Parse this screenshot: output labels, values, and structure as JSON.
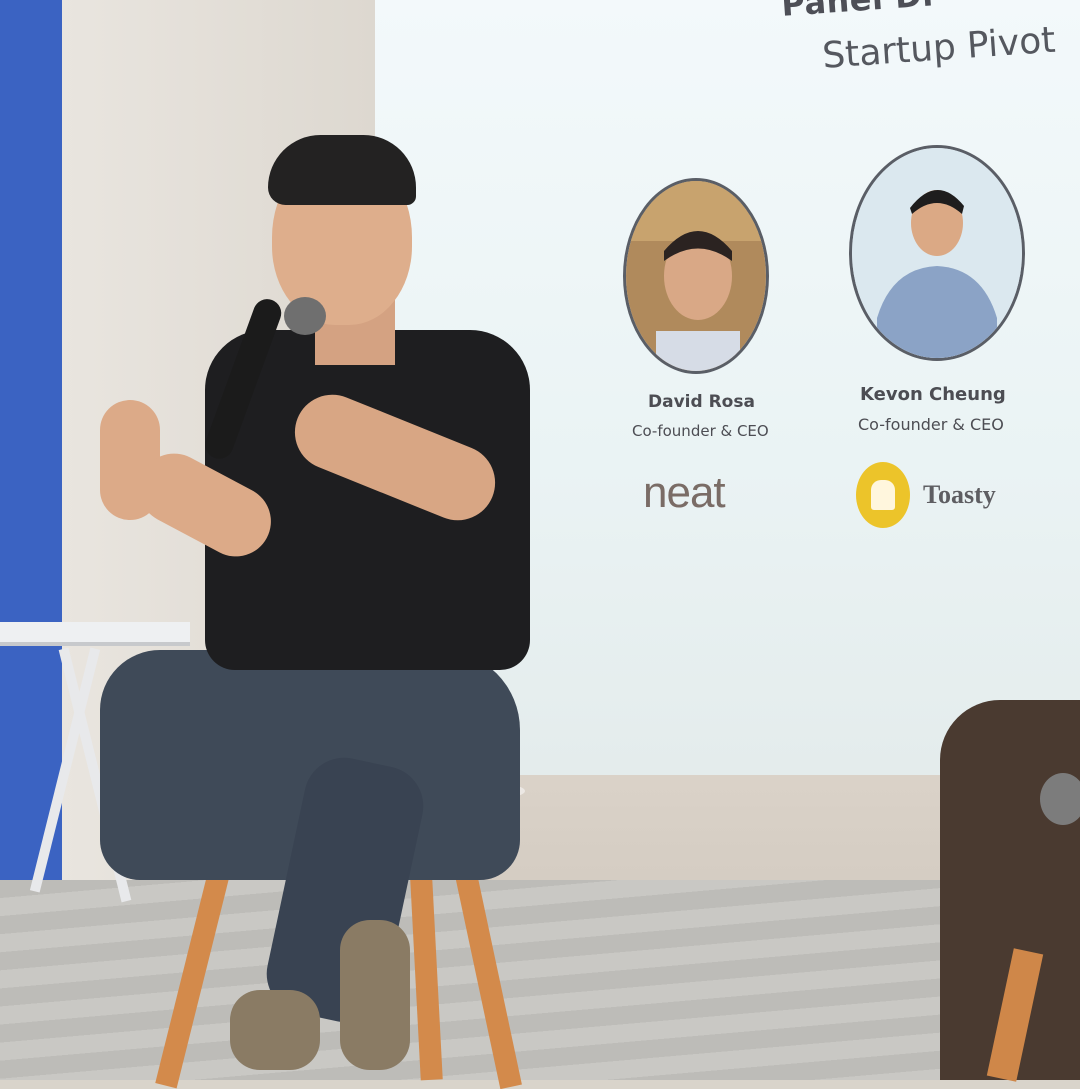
{
  "slide": {
    "title": "Panel Di",
    "subtitle": "Startup Pivot",
    "speakers": [
      {
        "name": "David Rosa",
        "role": "Co-founder & CEO",
        "company_logo": "neat"
      },
      {
        "name": "Kevon Cheung",
        "role": "Co-founder & CEO",
        "company_logo": "Toasty"
      }
    ]
  },
  "colors": {
    "slide_background": "#eef6f8",
    "wall_accent_blue": "#3b63c2",
    "toasty_yellow": "#ecc42a",
    "stool_wood": "#d38a4b"
  },
  "icons": {
    "toasty": "toast-bread-icon"
  }
}
